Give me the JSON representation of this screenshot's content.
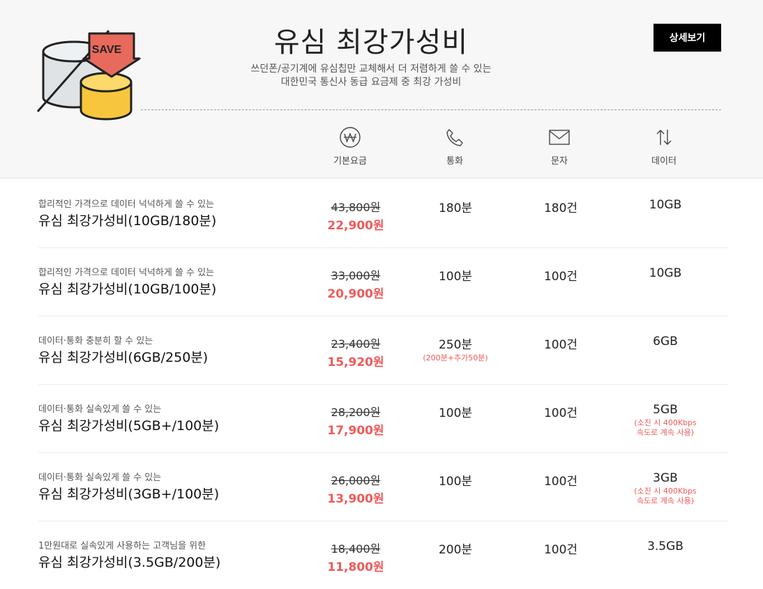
{
  "header": {
    "title": "유심 최강가성비",
    "subtitle_line1": "쓰던폰/공기계에 유심칩만 교체해서 더 저렴하게 쓸 수 있는",
    "subtitle_line2": "대한민국 통신사 동급 요금제 중 최강 가성비",
    "detail_button": "상세보기",
    "save_label": "SAVE"
  },
  "columns": {
    "fee": "기본요금",
    "call": "통화",
    "sms": "문자",
    "data": "데이터"
  },
  "icons": {
    "fee": "won-icon",
    "call": "phone-icon",
    "sms": "mail-icon",
    "data": "transfer-arrows-icon"
  },
  "colors": {
    "sale": "#f05a5a",
    "button_bg": "#000000",
    "header_bg": "#f7f7f7"
  },
  "plans": [
    {
      "desc": "합리적인 가격으로 데이터 넉넉하게 쓸 수 있는",
      "name": "유심 최강가성비(10GB/180분)",
      "orig_price": "43,800원",
      "sale_price": "22,900원",
      "call": "180분",
      "call_note": "",
      "sms": "180건",
      "data": "10GB",
      "data_note1": "",
      "data_note2": ""
    },
    {
      "desc": "합리적인 가격으로 데이터 넉넉하게 쓸 수 있는",
      "name": "유심 최강가성비(10GB/100분)",
      "orig_price": "33,000원",
      "sale_price": "20,900원",
      "call": "100분",
      "call_note": "",
      "sms": "100건",
      "data": "10GB",
      "data_note1": "",
      "data_note2": ""
    },
    {
      "desc": "데이터·통화 충분히 할 수 있는",
      "name": "유심 최강가성비(6GB/250분)",
      "orig_price": "23,400원",
      "sale_price": "15,920원",
      "call": "250분",
      "call_note": "(200분+추가50분)",
      "sms": "100건",
      "data": "6GB",
      "data_note1": "",
      "data_note2": ""
    },
    {
      "desc": "데이터·통화 실속있게 쓸 수 있는",
      "name": "유심 최강가성비(5GB+/100분)",
      "orig_price": "28,200원",
      "sale_price": "17,900원",
      "call": "100분",
      "call_note": "",
      "sms": "100건",
      "data": "5GB",
      "data_note1": "(소진 시 400Kbps",
      "data_note2": "속도로 계속 사용)"
    },
    {
      "desc": "데이터·통화 실속있게 쓸 수 있는",
      "name": "유심 최강가성비(3GB+/100분)",
      "orig_price": "26,000원",
      "sale_price": "13,900원",
      "call": "100분",
      "call_note": "",
      "sms": "100건",
      "data": "3GB",
      "data_note1": "(소진 시 400Kbps",
      "data_note2": "속도로 계속 사용)"
    },
    {
      "desc": "1만원대로 실속있게 사용하는 고객님을 위한",
      "name": "유심 최강가성비(3.5GB/200분)",
      "orig_price": "18,400원",
      "sale_price": "11,800원",
      "call": "200분",
      "call_note": "",
      "sms": "100건",
      "data": "3.5GB",
      "data_note1": "",
      "data_note2": ""
    }
  ]
}
